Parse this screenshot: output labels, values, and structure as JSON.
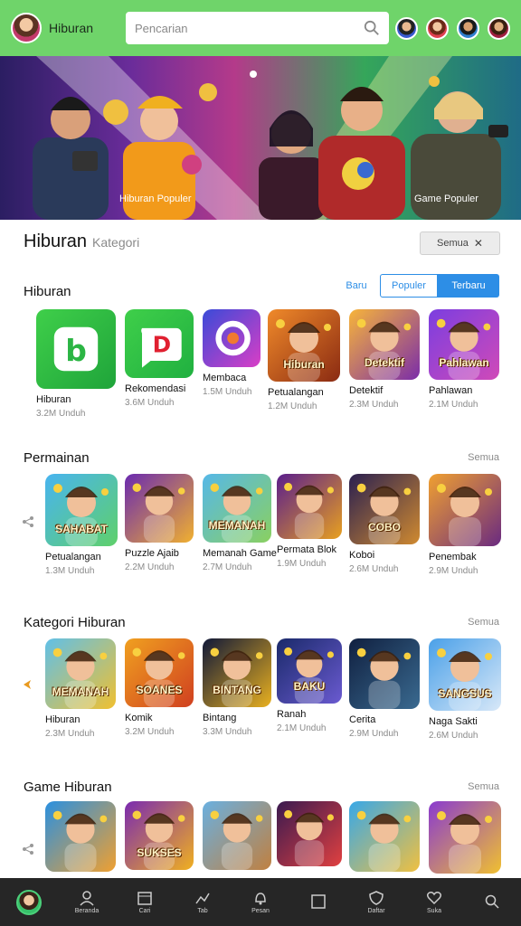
{
  "header": {
    "app_name": "Hiburan",
    "search_placeholder": "Pencarian",
    "bg_color": "#6fd46a"
  },
  "hero": {
    "caption_left": "Hiburan Populer",
    "caption_right": "Game Populer"
  },
  "subheader": {
    "title": "Hiburan",
    "subtitle": "Kategori",
    "button_label": "Semua"
  },
  "section1": {
    "title": "Hiburan",
    "tabs": [
      "Baru",
      "Populer",
      "Terbaru"
    ],
    "accent": "#2d8ee6",
    "items": [
      {
        "title": "Hiburan",
        "meta": "3.2M Unduh",
        "colors": [
          "#3fcf4a",
          "#1fa43a"
        ],
        "icon": "b-app-icon",
        "tile_text": ""
      },
      {
        "title": "Rekomendasi",
        "meta": "3.6M Unduh",
        "colors": [
          "#3fcf4a",
          "#20b040"
        ],
        "icon": "d-app-icon",
        "tile_text": ""
      },
      {
        "title": "Membaca",
        "meta": "1.5M Unduh",
        "colors": [
          "#3a4bd8",
          "#d93ec6"
        ],
        "icon": "ring-app-icon",
        "tile_text": ""
      },
      {
        "title": "Petualangan",
        "meta": "1.2M Unduh",
        "colors": [
          "#f08a2a",
          "#8a2a12"
        ],
        "icon": "hero-girl-icon",
        "tile_text": "Hiburan"
      },
      {
        "title": "Detektif",
        "meta": "2.3M Unduh",
        "colors": [
          "#f7b43a",
          "#7b2da8"
        ],
        "icon": "cowboy-icon",
        "tile_text": "Detektif"
      },
      {
        "title": "Pahlawan",
        "meta": "2.1M Unduh",
        "colors": [
          "#7b3ee0",
          "#d04ab8"
        ],
        "icon": "pirate-icon",
        "tile_text": "Pahlawan"
      }
    ]
  },
  "section2": {
    "title": "Permainan",
    "more": "Semua",
    "items": [
      {
        "title": "Petualangan",
        "meta": "1.3M Unduh",
        "colors": [
          "#48b4f0",
          "#5fd06a"
        ],
        "icon": "adventure-icon",
        "tile_text": "SAHABAT"
      },
      {
        "title": "Puzzle Ajaib",
        "meta": "2.2M Unduh",
        "colors": [
          "#6a2ab0",
          "#f0b030"
        ],
        "icon": "puzzle-icon",
        "tile_text": ""
      },
      {
        "title": "Memanah Game",
        "meta": "2.7M Unduh",
        "colors": [
          "#56b8e8",
          "#8ad060"
        ],
        "icon": "archer-icon",
        "tile_text": "MEMANAH"
      },
      {
        "title": "Permata Blok",
        "meta": "1.9M Unduh",
        "colors": [
          "#5a1e8c",
          "#e8a020"
        ],
        "icon": "gem-icon",
        "tile_text": ""
      },
      {
        "title": "Koboi",
        "meta": "2.6M Unduh",
        "colors": [
          "#2a2050",
          "#d08a30"
        ],
        "icon": "cowboy-icon",
        "tile_text": "COBO"
      },
      {
        "title": "Penembak",
        "meta": "2.9M Unduh",
        "colors": [
          "#f0a030",
          "#6a2a80"
        ],
        "icon": "gunner-icon",
        "tile_text": ""
      }
    ]
  },
  "section3": {
    "title": "Kategori Hiburan",
    "more": "Semua",
    "items": [
      {
        "title": "Hiburan",
        "meta": "2.3M Unduh",
        "colors": [
          "#60c0e8",
          "#f0c030"
        ],
        "icon": "detective-icon",
        "tile_text": "MEMANAH"
      },
      {
        "title": "Komik",
        "meta": "3.2M Unduh",
        "colors": [
          "#f0a020",
          "#d04020"
        ],
        "icon": "comic-icon",
        "tile_text": "SOANES"
      },
      {
        "title": "Bintang",
        "meta": "3.3M Unduh",
        "colors": [
          "#101838",
          "#e8b020"
        ],
        "icon": "star-icon",
        "tile_text": "BINTANG"
      },
      {
        "title": "Ranah",
        "meta": "2.1M Unduh",
        "colors": [
          "#1a2a6a",
          "#6a5ad0"
        ],
        "icon": "warrior-icon",
        "tile_text": "BAKU"
      },
      {
        "title": "Cerita",
        "meta": "2.9M Unduh",
        "colors": [
          "#102040",
          "#3a6a90"
        ],
        "icon": "soldier-icon",
        "tile_text": ""
      },
      {
        "title": "Naga Sakti",
        "meta": "2.6M Unduh",
        "colors": [
          "#4aa0e8",
          "#d8e8f8"
        ],
        "icon": "winged-icon",
        "tile_text": "SANGSUS"
      }
    ]
  },
  "section4": {
    "title": "Game Hiburan",
    "more": "Semua",
    "items": [
      {
        "colors": [
          "#2a90e0",
          "#f0a030"
        ],
        "icon": "boy-icon",
        "tile_text": ""
      },
      {
        "colors": [
          "#7a2ab0",
          "#f0b020"
        ],
        "icon": "wizard-icon",
        "tile_text": "SUKSES"
      },
      {
        "colors": [
          "#6ab0e0",
          "#c08040"
        ],
        "icon": "dwarf-icon",
        "tile_text": ""
      },
      {
        "colors": [
          "#3a1a50",
          "#e04040"
        ],
        "icon": "ninja-icon",
        "tile_text": ""
      },
      {
        "colors": [
          "#38a8e8",
          "#f0c040"
        ],
        "icon": "coin-icon",
        "tile_text": ""
      },
      {
        "colors": [
          "#8a3ad0",
          "#f0c030"
        ],
        "icon": "ring-icon",
        "tile_text": ""
      }
    ]
  },
  "bottom_nav": {
    "items": [
      {
        "label": "",
        "icon": "profile-avatar-icon"
      },
      {
        "label": "Beranda",
        "icon": "person-icon"
      },
      {
        "label": "Cari",
        "icon": "calendar-icon"
      },
      {
        "label": "Tab",
        "icon": "chart-icon"
      },
      {
        "label": "Pesan",
        "icon": "bell-icon"
      },
      {
        "label": "",
        "icon": "square-icon"
      },
      {
        "label": "Daftar",
        "icon": "shield-icon"
      },
      {
        "label": "Suka",
        "icon": "heart-icon"
      },
      {
        "label": "",
        "icon": "search-icon"
      }
    ]
  }
}
